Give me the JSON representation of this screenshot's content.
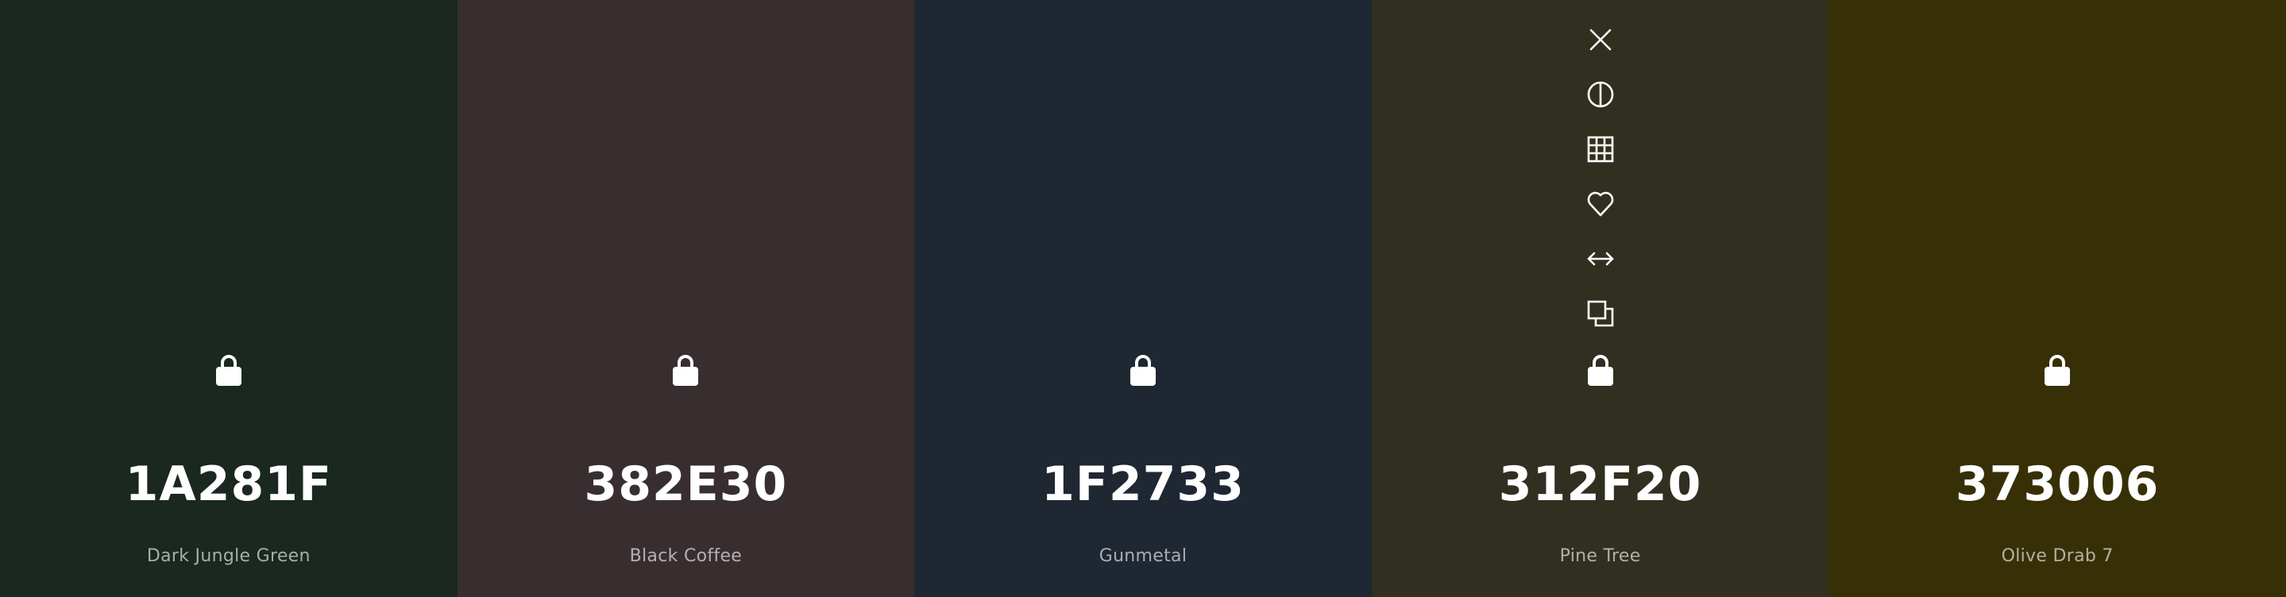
{
  "swatches": [
    {
      "hex": "1A281F",
      "name": "Dark Jungle Green",
      "color": "#1A281F",
      "lock_icon": "lock-icon"
    },
    {
      "hex": "382E30",
      "name": "Black Coffee",
      "color": "#382E30",
      "lock_icon": "lock-icon"
    },
    {
      "hex": "1F2733",
      "name": "Gunmetal",
      "color": "#1F2733",
      "lock_icon": "lock-icon"
    },
    {
      "hex": "312F20",
      "name": "Pine Tree",
      "color": "#312F20",
      "lock_icon": "lock-icon"
    },
    {
      "hex": "373006",
      "name": "Olive Drab 7",
      "color": "#373006",
      "lock_icon": "lock-icon"
    }
  ],
  "hover_toolbar": {
    "on_swatch": "Pine Tree",
    "icons": [
      "close-icon",
      "contrast-icon",
      "shades-grid-icon",
      "heart-icon",
      "drag-arrows-icon",
      "copy-icon"
    ]
  },
  "text_color": "#FFFFFF"
}
